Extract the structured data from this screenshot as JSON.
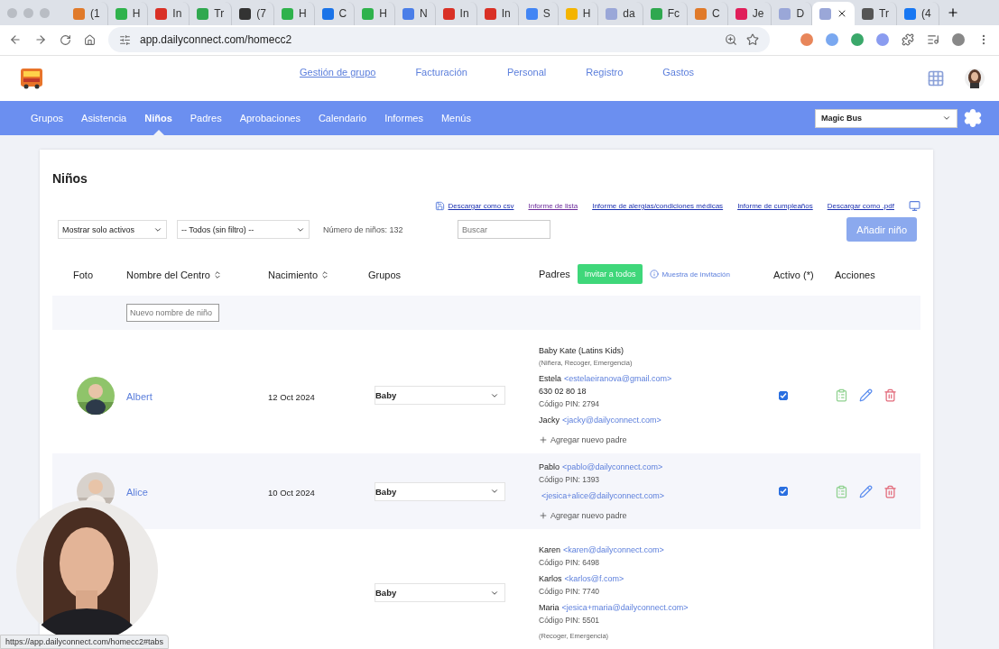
{
  "browser": {
    "tabs": [
      {
        "label": "(1",
        "color": "#e07a2a",
        "selected": false
      },
      {
        "label": "H",
        "color": "#2fb24c",
        "selected": false
      },
      {
        "label": "In",
        "color": "#d93025",
        "selected": false
      },
      {
        "label": "Tr",
        "color": "#2fa84f",
        "selected": false
      },
      {
        "label": "(7",
        "color": "#333333",
        "selected": false
      },
      {
        "label": "H",
        "color": "#2fb24c",
        "selected": false
      },
      {
        "label": "C",
        "color": "#1a73e8",
        "selected": false
      },
      {
        "label": "H",
        "color": "#2fb24c",
        "selected": false
      },
      {
        "label": "N",
        "color": "#4a7ee8",
        "selected": false
      },
      {
        "label": "In",
        "color": "#d93025",
        "selected": false
      },
      {
        "label": "In",
        "color": "#d93025",
        "selected": false
      },
      {
        "label": "S",
        "color": "#4285f4",
        "selected": false
      },
      {
        "label": "H",
        "color": "#f4b400",
        "selected": false
      },
      {
        "label": "da",
        "color": "#9aa7d8",
        "selected": false
      },
      {
        "label": "Fc",
        "color": "#2fa84f",
        "selected": false
      },
      {
        "label": "C",
        "color": "#e07a2a",
        "selected": false
      },
      {
        "label": "Je",
        "color": "#e01e5a",
        "selected": false
      },
      {
        "label": "D",
        "color": "#9aa7d8",
        "selected": false
      },
      {
        "color": "#9aa7d8",
        "selected": true
      },
      {
        "label": "Tr",
        "color": "#555555",
        "selected": false
      },
      {
        "label": "(4",
        "color": "#1877f2",
        "selected": false
      }
    ],
    "url": "app.dailyconnect.com/homecc2"
  },
  "top_nav": [
    {
      "label": "Gestión de grupo",
      "selected": true
    },
    {
      "label": "Facturación",
      "selected": false
    },
    {
      "label": "Personal",
      "selected": false
    },
    {
      "label": "Registro",
      "selected": false
    },
    {
      "label": "Gastos",
      "selected": false
    }
  ],
  "main_nav": [
    {
      "label": "Grupos",
      "selected": false
    },
    {
      "label": "Asistencia",
      "selected": false
    },
    {
      "label": "Niños",
      "selected": true
    },
    {
      "label": "Padres",
      "selected": false
    },
    {
      "label": "Aprobaciones",
      "selected": false
    },
    {
      "label": "Calendario",
      "selected": false
    },
    {
      "label": "Informes",
      "selected": false
    },
    {
      "label": "Menús",
      "selected": false
    }
  ],
  "center_select": "Magic Bus",
  "page": {
    "title": "Niños",
    "links": [
      {
        "label": "Descargar como csv",
        "kind": "save"
      },
      {
        "label": "Informe de lista",
        "kind": "visited"
      },
      {
        "label": "Informe de alergias/condiciones médicas",
        "kind": "plain"
      },
      {
        "label": "Informe de cumpleaños",
        "kind": "plain"
      },
      {
        "label": "Descargar como .pdf",
        "kind": "plain"
      }
    ],
    "status_filter": "Mostrar solo activos",
    "group_filter": "-- Todos (sin filtro) --",
    "count": "Número de niños: 132",
    "search_placeholder": "Buscar",
    "add_button": "Añadir niño"
  },
  "table": {
    "columns": [
      {
        "label": "Foto",
        "sortable": false
      },
      {
        "label": "Nombre del Centro",
        "sortable": true
      },
      {
        "label": "Nacimiento",
        "sortable": true
      },
      {
        "label": "Grupos",
        "sortable": false
      },
      {
        "label": "Padres",
        "sortable": false
      },
      {
        "label": "Activo (*)",
        "sortable": false
      },
      {
        "label": "Acciones",
        "sortable": false
      }
    ],
    "invite_button": "Invitar a todos",
    "invite_sample": "Muestra de invitación",
    "new_name_placeholder": "Nuevo nombre de niño",
    "rows": [
      {
        "name": "Albert",
        "birth": "12 Oct 2024",
        "group": "Baby",
        "active": true,
        "add_parent": "Agregar nuevo padre",
        "parents": [
          {
            "name": "Baby Kate (Latins Kids)",
            "roles": "(Niñera, Recoger, Emergencia)"
          },
          {
            "name": "Estela",
            "email": "<estelaeiranova@gmail.com>",
            "phone": "630 02 80 18",
            "pin": "Código PIN: 2794"
          },
          {
            "name": "Jacky",
            "email": "<jacky@dailyconnect.com>"
          }
        ]
      },
      {
        "name": "Alice",
        "birth": "10 Oct 2024",
        "group": "Baby",
        "active": true,
        "add_parent": "Agregar nuevo padre",
        "parents": [
          {
            "name": "Pablo",
            "email": "<pablo@dailyconnect.com>",
            "pin": "Código PIN: 1393"
          },
          {
            "email": "<jesica+alice@dailyconnect.com>"
          }
        ]
      },
      {
        "group": "Baby",
        "parents": [
          {
            "name": "Karen",
            "email": "<karen@dailyconnect.com>",
            "pin": "Código PIN: 6498"
          },
          {
            "name": "Karlos",
            "email": "<karlos@f.com>",
            "pin": "Código PIN: 7740"
          },
          {
            "name": "Maria",
            "email": "<jesica+maria@dailyconnect.com>",
            "pin": "Código PIN: 5501"
          },
          {
            "roles": "(Recoger, Emergencia)"
          }
        ]
      }
    ]
  },
  "status_url": "https://app.dailyconnect.com/homecc2#tabs"
}
